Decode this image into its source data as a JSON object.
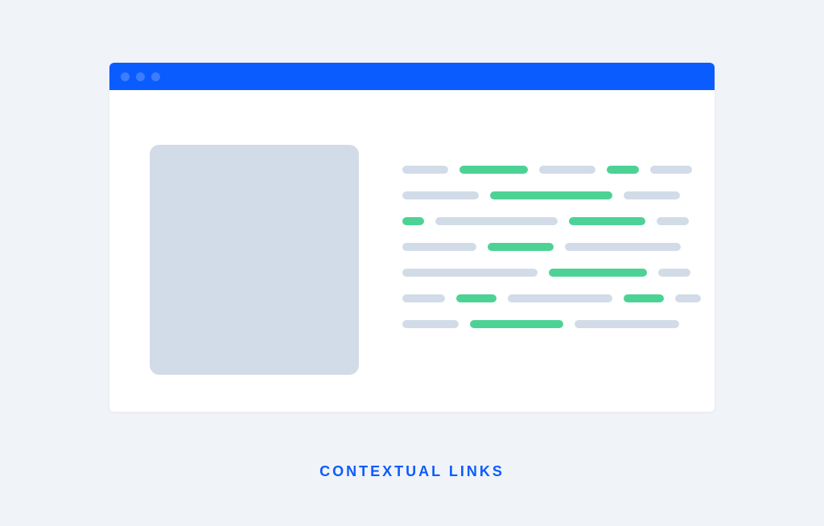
{
  "caption": "CONTEXTUAL LINKS",
  "colors": {
    "background": "#f0f3f7",
    "window_bg": "#ffffff",
    "titlebar": "#0b5cff",
    "titlebar_dot": "#3d7dff",
    "text_placeholder": "#d2dce8",
    "link_highlight": "#4dd296",
    "caption_text": "#0b5cff"
  },
  "window": {
    "dots": 3
  },
  "text_lines": [
    [
      {
        "type": "text",
        "width": 57
      },
      {
        "type": "link",
        "width": 85
      },
      {
        "type": "text",
        "width": 70
      },
      {
        "type": "link",
        "width": 40
      },
      {
        "type": "text",
        "width": 52
      }
    ],
    [
      {
        "type": "text",
        "width": 95
      },
      {
        "type": "link",
        "width": 152
      },
      {
        "type": "text",
        "width": 70
      }
    ],
    [
      {
        "type": "link",
        "width": 27
      },
      {
        "type": "text",
        "width": 152
      },
      {
        "type": "link",
        "width": 95
      },
      {
        "type": "text",
        "width": 40
      }
    ],
    [
      {
        "type": "text",
        "width": 92
      },
      {
        "type": "link",
        "width": 82
      },
      {
        "type": "text",
        "width": 144
      }
    ],
    [
      {
        "type": "text",
        "width": 168
      },
      {
        "type": "link",
        "width": 122
      },
      {
        "type": "text",
        "width": 40
      }
    ],
    [
      {
        "type": "text",
        "width": 53
      },
      {
        "type": "link",
        "width": 50
      },
      {
        "type": "text",
        "width": 130
      },
      {
        "type": "link",
        "width": 50
      },
      {
        "type": "text",
        "width": 32
      }
    ],
    [
      {
        "type": "text",
        "width": 70
      },
      {
        "type": "link",
        "width": 116
      },
      {
        "type": "text",
        "width": 130
      }
    ]
  ]
}
